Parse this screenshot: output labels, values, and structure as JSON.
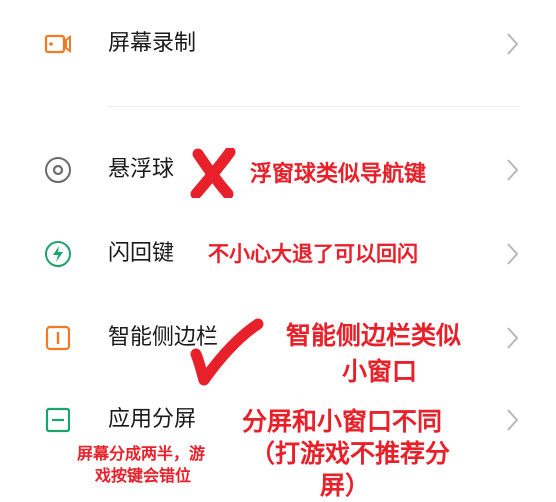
{
  "settings": {
    "items": [
      {
        "label": "屏幕录制",
        "icon": "screen-record-icon"
      },
      {
        "label": "悬浮球",
        "icon": "floating-ball-icon"
      },
      {
        "label": "闪回键",
        "icon": "flashback-key-icon"
      },
      {
        "label": "智能侧边栏",
        "icon": "smart-sidebar-icon"
      },
      {
        "label": "应用分屏",
        "icon": "split-screen-icon"
      }
    ]
  },
  "annotations": {
    "floating_ball": "浮窗球类似导航键",
    "flashback": "不小心大退了可以回闪",
    "sidebar_line1": "智能侧边栏类似",
    "sidebar_line2": "小窗口",
    "split_line1": "分屏和小窗口不同",
    "split_line2": "（打游戏不推荐分",
    "split_line3": "屏）",
    "split_left_line1": "屏幕分成两半，游",
    "split_left_line2": "戏按键会错位"
  },
  "colors": {
    "icon_orange": "#f07a24",
    "icon_gray": "#6b6b6b",
    "icon_green": "#1aa36b",
    "annotation_red": "#e8202a",
    "chevron": "#b8b8b8"
  }
}
